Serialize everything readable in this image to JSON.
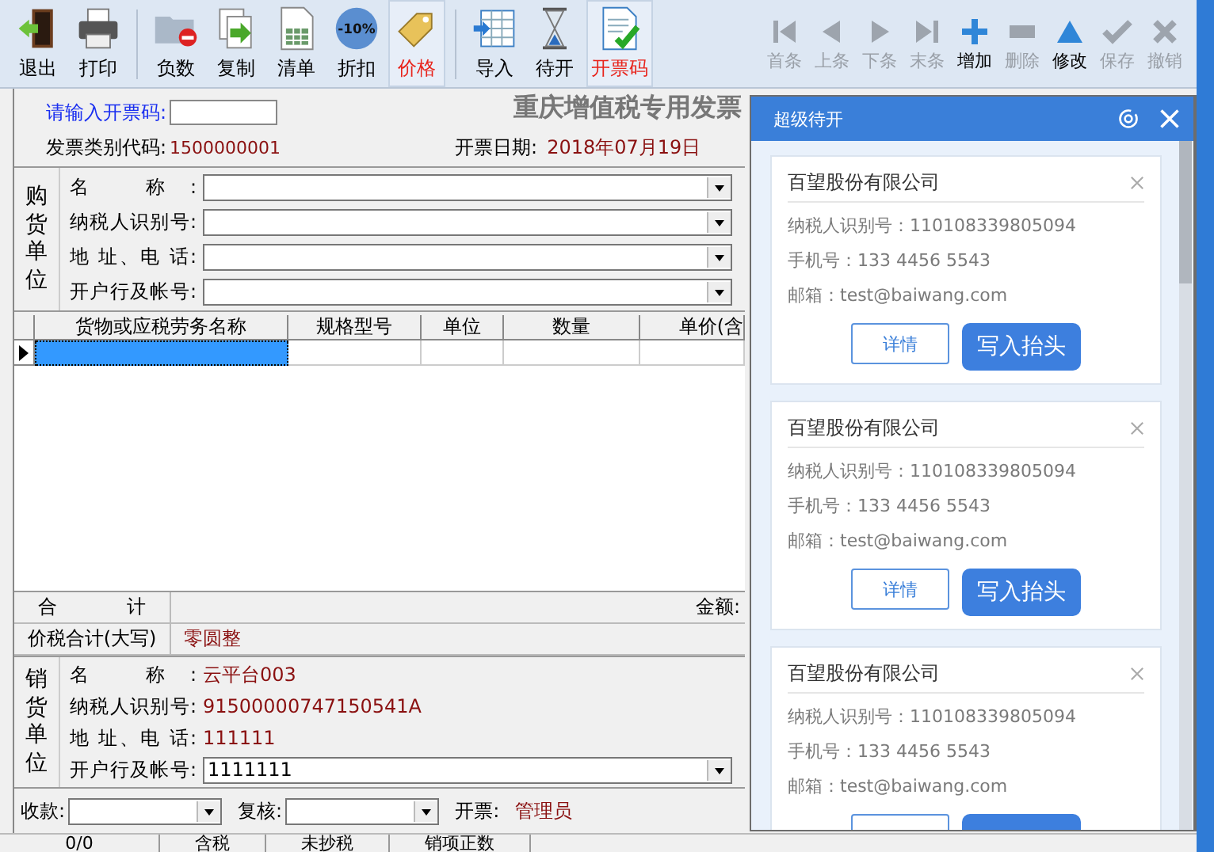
{
  "toolbar": {
    "tools": [
      {
        "kind": "exit",
        "label": "退出",
        "selected": false
      },
      {
        "kind": "print",
        "label": "打印",
        "selected": false
      },
      {
        "kind": "negative",
        "label": "负数",
        "selected": false
      },
      {
        "kind": "copy",
        "label": "复制",
        "selected": false
      },
      {
        "kind": "list",
        "label": "清单",
        "selected": false
      },
      {
        "kind": "discount",
        "label": "折扣",
        "badge": "-10%",
        "selected": false
      },
      {
        "kind": "price",
        "label": "价格",
        "selected": true
      },
      {
        "kind": "import",
        "label": "导入",
        "selected": false
      },
      {
        "kind": "pending",
        "label": "待开",
        "selected": false
      },
      {
        "kind": "code",
        "label": "开票码",
        "selected": true
      }
    ],
    "nav": [
      {
        "kind": "first",
        "label": "首条",
        "disabled": true
      },
      {
        "kind": "prev",
        "label": "上条",
        "disabled": true
      },
      {
        "kind": "next",
        "label": "下条",
        "disabled": true
      },
      {
        "kind": "last",
        "label": "末条",
        "disabled": true
      },
      {
        "kind": "add",
        "label": "增加",
        "disabled": false
      },
      {
        "kind": "delete",
        "label": "删除",
        "disabled": true
      },
      {
        "kind": "edit",
        "label": "修改",
        "disabled": false
      },
      {
        "kind": "save",
        "label": "保存",
        "disabled": true
      },
      {
        "kind": "cancel",
        "label": "撤销",
        "disabled": true
      }
    ]
  },
  "invoice": {
    "title": "重庆增值税专用发票",
    "code_prompt": "请输入开票码:",
    "category_label": "发票类别代码:",
    "category_code": "1500000001",
    "date_label": "开票日期:",
    "date": "2018年07月19日",
    "buyer": {
      "section_label": "购货单位",
      "fields": [
        {
          "label": "名 称:",
          "kind": "dropdown"
        },
        {
          "label": "纳税人识别号:",
          "kind": "dropdown"
        },
        {
          "label": "地 址、电 话:",
          "kind": "dropdown"
        },
        {
          "label": "开户行及帐号:",
          "kind": "dropdown"
        }
      ]
    },
    "table": {
      "columns": [
        "货物或应税劳务名称",
        "规格型号",
        "单位",
        "数量",
        "单价(含"
      ],
      "rows": [
        {
          "selected": true
        }
      ]
    },
    "totals": {
      "sum_label": "合 计",
      "amount_label": "金额:",
      "total_label": "价税合计(大写)",
      "total_value": "零圆整"
    },
    "seller": {
      "section_label": "销货单位",
      "fields": [
        {
          "label": "名 称:",
          "kind": "text",
          "value": "云平台003"
        },
        {
          "label": "纳税人识别号:",
          "kind": "text",
          "value": "91500000747150541A"
        },
        {
          "label": "地 址、电 话:",
          "kind": "text",
          "value": "111111"
        },
        {
          "label": "开户行及帐号:",
          "kind": "dropdown",
          "value": "1111111"
        }
      ]
    },
    "signoff": [
      {
        "label": "收款:",
        "kind": "dropdown"
      },
      {
        "label": "复核:",
        "kind": "dropdown"
      },
      {
        "label": "开票:",
        "kind": "text",
        "value": "管理员"
      }
    ]
  },
  "status_bar": [
    "0/0",
    "含税",
    "未抄税",
    "销项正数"
  ],
  "panel": {
    "title": "超级待开",
    "cards": [
      {
        "company": "百望股份有限公司",
        "tax_id": "纳税人识别号：110108339805094",
        "phone": "手机号：133 4456 5543",
        "email": "邮箱：test@baiwang.com",
        "details_label": "详情",
        "write_label": "写入抬头"
      },
      {
        "company": "百望股份有限公司",
        "tax_id": "纳税人识别号：110108339805094",
        "phone": "手机号：133 4456 5543",
        "email": "邮箱：test@baiwang.com",
        "details_label": "详情",
        "write_label": "写入抬头"
      },
      {
        "company": "百望股份有限公司",
        "tax_id": "纳税人识别号：110108339805094",
        "phone": "手机号：133 4456 5543",
        "email": "邮箱：test@baiwang.com"
      }
    ]
  }
}
